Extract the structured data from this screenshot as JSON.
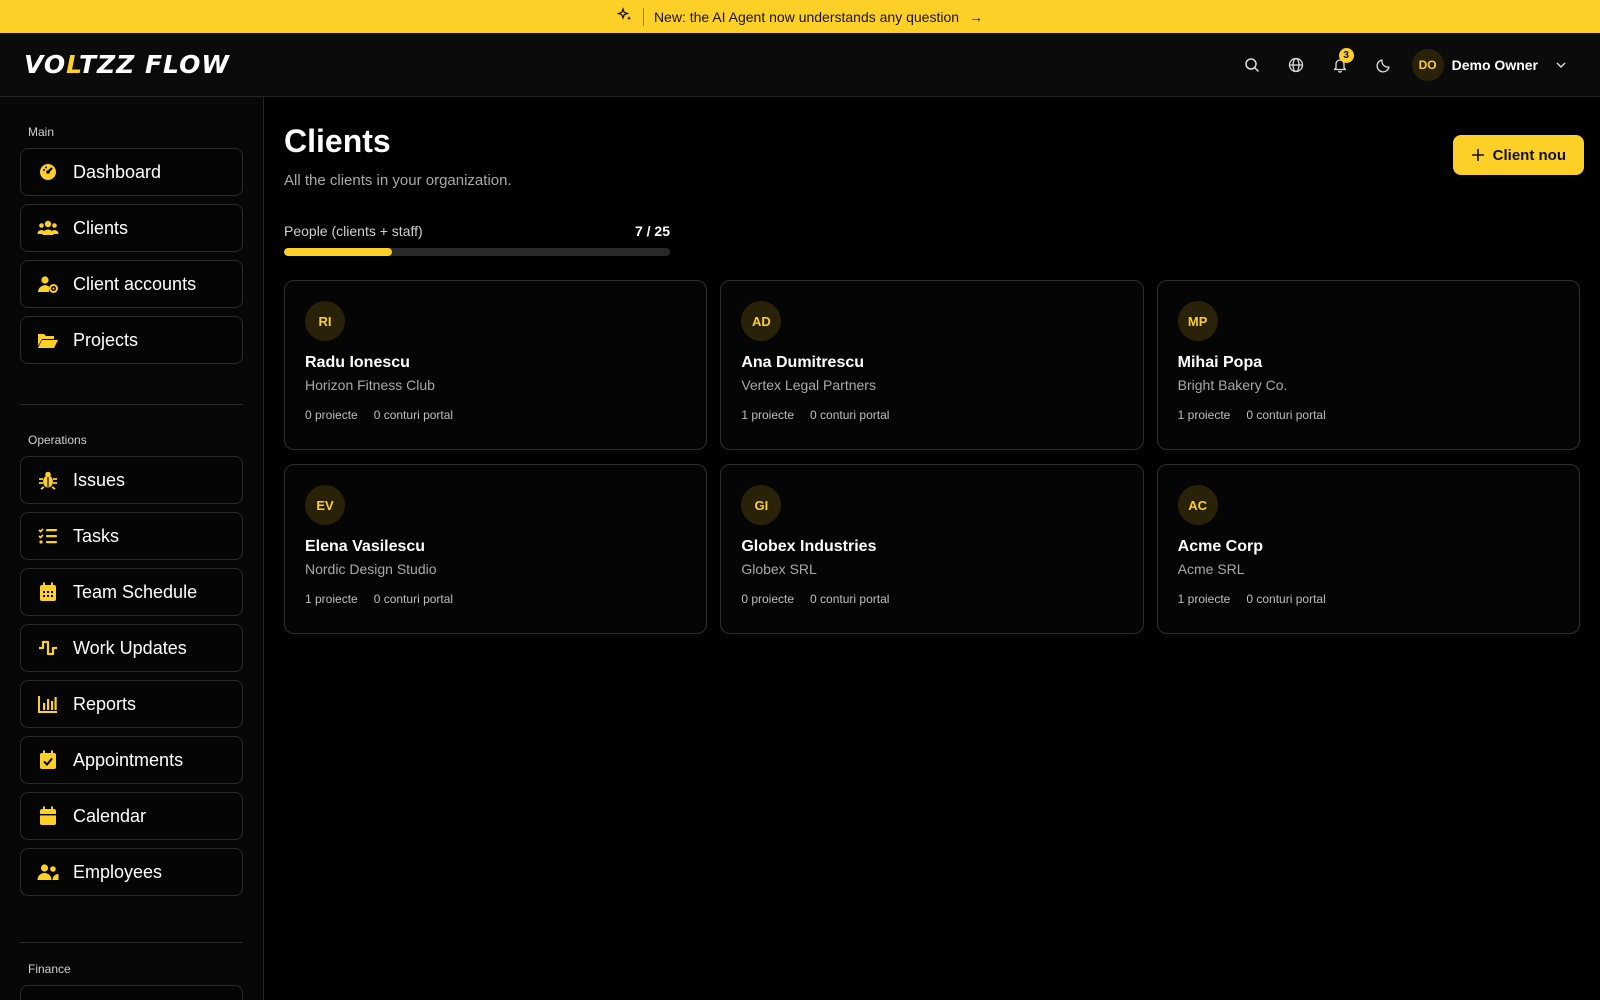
{
  "banner": {
    "text": "New: the AI Agent now understands any question",
    "arrow": "→"
  },
  "header": {
    "logo": {
      "part1": "VO",
      "accent": "L",
      "part2": "TZZ FLOW"
    },
    "notifications_count": "3",
    "user": {
      "initials": "DO",
      "name": "Demo Owner"
    }
  },
  "sidebar": {
    "sections": [
      {
        "label": "Main",
        "items": [
          "Dashboard",
          "Clients",
          "Client accounts",
          "Projects"
        ]
      },
      {
        "label": "Operations",
        "items": [
          "Issues",
          "Tasks",
          "Team Schedule",
          "Work Updates",
          "Reports",
          "Appointments",
          "Calendar",
          "Employees"
        ]
      },
      {
        "label": "Finance",
        "items": []
      }
    ]
  },
  "main": {
    "title": "Clients",
    "subtitle": "All the clients in your organization.",
    "new_button": "Client nou",
    "quota": {
      "label": "People (clients + staff)",
      "value": "7 / 25",
      "fraction": 0.28
    },
    "clients": [
      {
        "initials": "RI",
        "name": "Radu Ionescu",
        "company": "Horizon Fitness Club",
        "projects": "0 proiecte",
        "portal": "0 conturi portal"
      },
      {
        "initials": "AD",
        "name": "Ana Dumitrescu",
        "company": "Vertex Legal Partners",
        "projects": "1 proiecte",
        "portal": "0 conturi portal"
      },
      {
        "initials": "MP",
        "name": "Mihai Popa",
        "company": "Bright Bakery Co.",
        "projects": "1 proiecte",
        "portal": "0 conturi portal"
      },
      {
        "initials": "EV",
        "name": "Elena Vasilescu",
        "company": "Nordic Design Studio",
        "projects": "1 proiecte",
        "portal": "0 conturi portal"
      },
      {
        "initials": "GI",
        "name": "Globex Industries",
        "company": "Globex SRL",
        "projects": "0 proiecte",
        "portal": "0 conturi portal"
      },
      {
        "initials": "AC",
        "name": "Acme Corp",
        "company": "Acme SRL",
        "projects": "1 proiecte",
        "portal": "0 conturi portal"
      }
    ]
  },
  "colors": {
    "accent": "#fcd027",
    "background": "#000000"
  }
}
